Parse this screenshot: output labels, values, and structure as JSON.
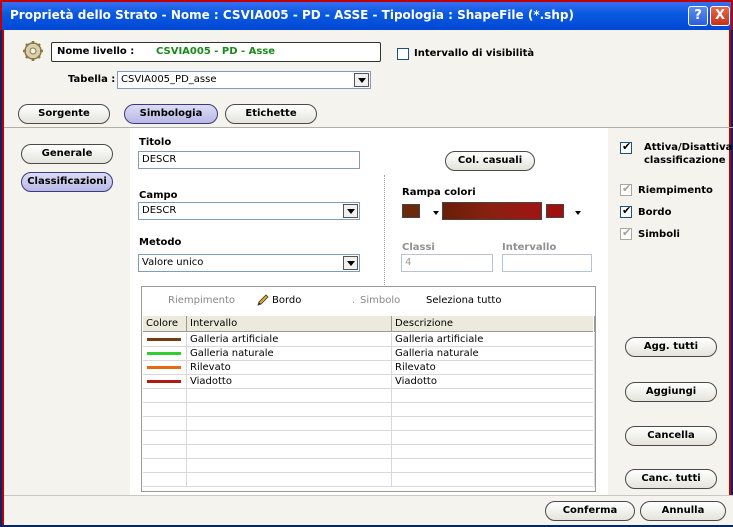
{
  "window": {
    "title": "Proprietà dello Strato - Nome : CSVIA005 - PD - ASSE - Tipologia : ShapeFile (*.shp)",
    "help_label": "?",
    "close_label": "X"
  },
  "header": {
    "name_label": "Nome livello :",
    "name_value": "CSVIA005 - PD - Asse",
    "visibility_label": "Intervallo di visibilità",
    "visibility_checked": false,
    "table_label": "Tabella :",
    "table_value": "CSVIA005_PD_asse"
  },
  "tabs": [
    {
      "label": "Sorgente",
      "active": false
    },
    {
      "label": "Simbologia",
      "active": true
    },
    {
      "label": "Etichette",
      "active": false
    }
  ],
  "side_nav": [
    {
      "label": "Generale",
      "active": false
    },
    {
      "label": "Classificazioni",
      "active": true
    }
  ],
  "form": {
    "title_label": "Titolo",
    "title_value": "DESCR",
    "field_label": "Campo",
    "field_value": "DESCR",
    "method_label": "Metodo",
    "method_value": "Valore unico",
    "random_colors_label": "Col. casuali",
    "ramp_label": "Rampa colori",
    "ramp_start_color": "#6a2a0a",
    "ramp_end_color": "#a01010",
    "classes_label": "Classi",
    "classes_value": "4",
    "interval_label": "Intervallo",
    "interval_value": ""
  },
  "options": {
    "toggle_label": "Attiva/Disattiva classificazione",
    "toggle_checked": true,
    "fill_label": "Riempimento",
    "fill_checked": true,
    "border_label": "Bordo",
    "border_checked": true,
    "symbols_label": "Simboli",
    "symbols_checked": true
  },
  "grid": {
    "toolbar": {
      "fill": "Riempimento",
      "border": "Bordo",
      "symbol": "Simbolo",
      "select_all": "Seleziona tutto"
    },
    "columns": [
      "Colore",
      "Intervallo",
      "Descrizione"
    ],
    "rows": [
      {
        "color": "#7a3a10",
        "interval": "Galleria artificiale",
        "description": "Galleria artificiale"
      },
      {
        "color": "#33cc33",
        "interval": "Galleria naturale",
        "description": "Galleria naturale"
      },
      {
        "color": "#e86a10",
        "interval": "Rilevato",
        "description": "Rilevato"
      },
      {
        "color": "#b01a10",
        "interval": "Viadotto",
        "description": "Viadotto"
      }
    ]
  },
  "actions": {
    "update_all": "Agg. tutti",
    "add": "Aggiungi",
    "delete": "Cancella",
    "delete_all": "Canc. tutti",
    "confirm": "Conferma",
    "cancel": "Annulla"
  }
}
